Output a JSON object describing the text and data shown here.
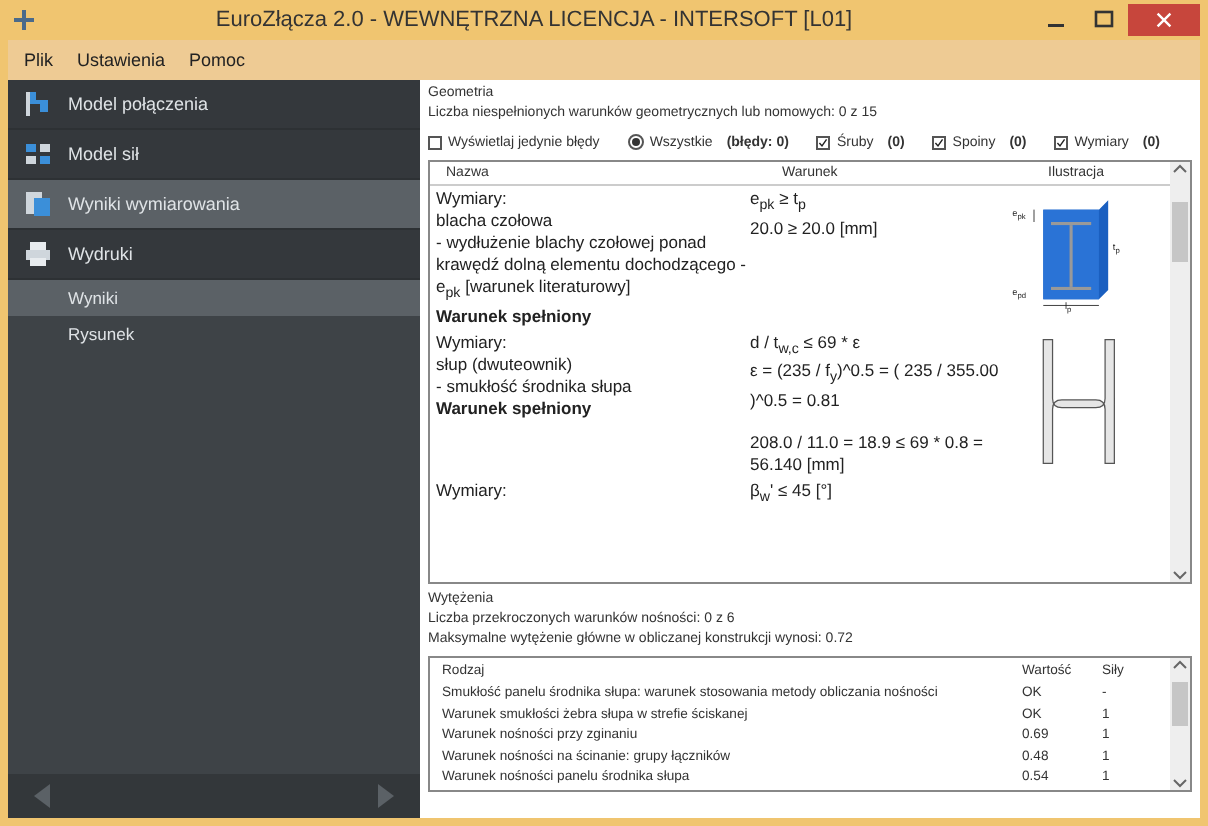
{
  "window": {
    "title": "EuroZłącza 2.0 - WEWNĘTRZNA LICENCJA - INTERSOFT [L01]"
  },
  "menu": [
    "Plik",
    "Ustawienia",
    "Pomoc"
  ],
  "sidebar": {
    "items": [
      {
        "label": "Model połączenia",
        "selected": false
      },
      {
        "label": "Model sił",
        "selected": false
      },
      {
        "label": "Wyniki wymiarowania",
        "selected": true
      },
      {
        "label": "Wydruki",
        "selected": false,
        "children": [
          {
            "label": "Wyniki",
            "selected": true
          },
          {
            "label": "Rysunek",
            "selected": false
          }
        ]
      }
    ]
  },
  "geometry": {
    "title": "Geometria",
    "summary": "Liczba niespełnionych warunków geometrycznych lub nomowych: 0 z 15",
    "filters": [
      {
        "kind": "checkbox",
        "label": "Wyświetlaj jedynie błędy",
        "checked": false
      },
      {
        "kind": "radio",
        "label": "Wszystkie",
        "selected": true,
        "count": "(błędy: 0)"
      },
      {
        "kind": "checkbox",
        "label": "Śruby",
        "checked": true,
        "count": "(0)"
      },
      {
        "kind": "checkbox",
        "label": "Spoiny",
        "checked": true,
        "count": "(0)"
      },
      {
        "kind": "checkbox",
        "label": "Wymiary",
        "checked": true,
        "count": "(0)"
      }
    ],
    "table": {
      "columns": [
        "Nazwa",
        "Warunek",
        "Ilustracja"
      ],
      "rows": [
        {
          "name": [
            "Wymiary:",
            "blacha czołowa",
            "- wydłużenie blachy czołowej ponad krawędź dolną elementu dochodzącego - e$_{pk}$ [warunek literaturowy]"
          ],
          "result": "Warunek spełniony",
          "condition": [
            "e$_{pk}$ ≥ t$_{p}$",
            "20.0 ≥ 20.0 [mm]"
          ],
          "kind": "plate",
          "labels": [
            "e$_{pk}$",
            "t$_{p}$",
            "e$_{pd}$",
            "l$_{p}$"
          ]
        },
        {
          "name": [
            "Wymiary:",
            "słup (dwuteownik)",
            "- smukłość środnika słupa"
          ],
          "result": "Warunek spełniony",
          "condition": [
            "d / t$_{w,c}$ ≤ 69 * ε",
            "ε = (235 / f$_{y}$)^0.5 = ( 235 / 355.00 )^0.5 = 0.81",
            "208.0 / 11.0 = 18.9 ≤ 69 * 0.8 = 56.140 [mm]"
          ],
          "kind": "section"
        },
        {
          "name": [
            "Wymiary:"
          ],
          "condition": [
            "β$_{w}$' ≤ 45 [°]"
          ]
        }
      ]
    }
  },
  "stress": {
    "title": "Wytężenia",
    "summary": "Liczba przekroczonych warunków nośności: 0 z 6",
    "max": "Maksymalne wytężenie główne w obliczanej konstrukcji wynosi: 0.72",
    "table": {
      "columns": [
        "Rodzaj",
        "Wartość",
        "Siły"
      ],
      "rows": [
        [
          "Smukłość panelu środnika słupa: warunek stosowania metody obliczania nośności",
          "OK",
          "-"
        ],
        [
          "Warunek smukłości żebra słupa w strefie ściskanej",
          "OK",
          "1"
        ],
        [
          "Warunek nośności przy zginaniu",
          "0.69",
          "1"
        ],
        [
          "Warunek nośności na ścinanie: grupy łączników",
          "0.48",
          "1"
        ],
        [
          "Warunek nośności panelu środnika słupa",
          "0.54",
          "1"
        ]
      ]
    }
  }
}
